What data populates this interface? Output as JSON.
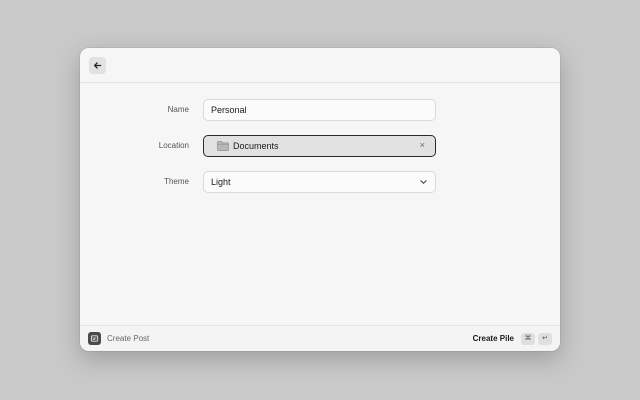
{
  "form": {
    "name_label": "Name",
    "name_value": "Personal",
    "location_label": "Location",
    "location_value": "Documents",
    "location_clear": "×",
    "theme_label": "Theme",
    "theme_value": "Light"
  },
  "footer": {
    "secondary_label": "Create Post",
    "primary_action": "Create Pile",
    "shortcut_cmd": "⌘",
    "shortcut_return": "↵"
  },
  "icons": {
    "back": "arrow-left-icon",
    "folder": "folder-icon",
    "chevron": "chevron-down-icon",
    "app": "app-icon"
  },
  "colors": {
    "background": "#c9c9c9",
    "window": "#f6f6f6",
    "focus_border": "#2a2a2a"
  }
}
